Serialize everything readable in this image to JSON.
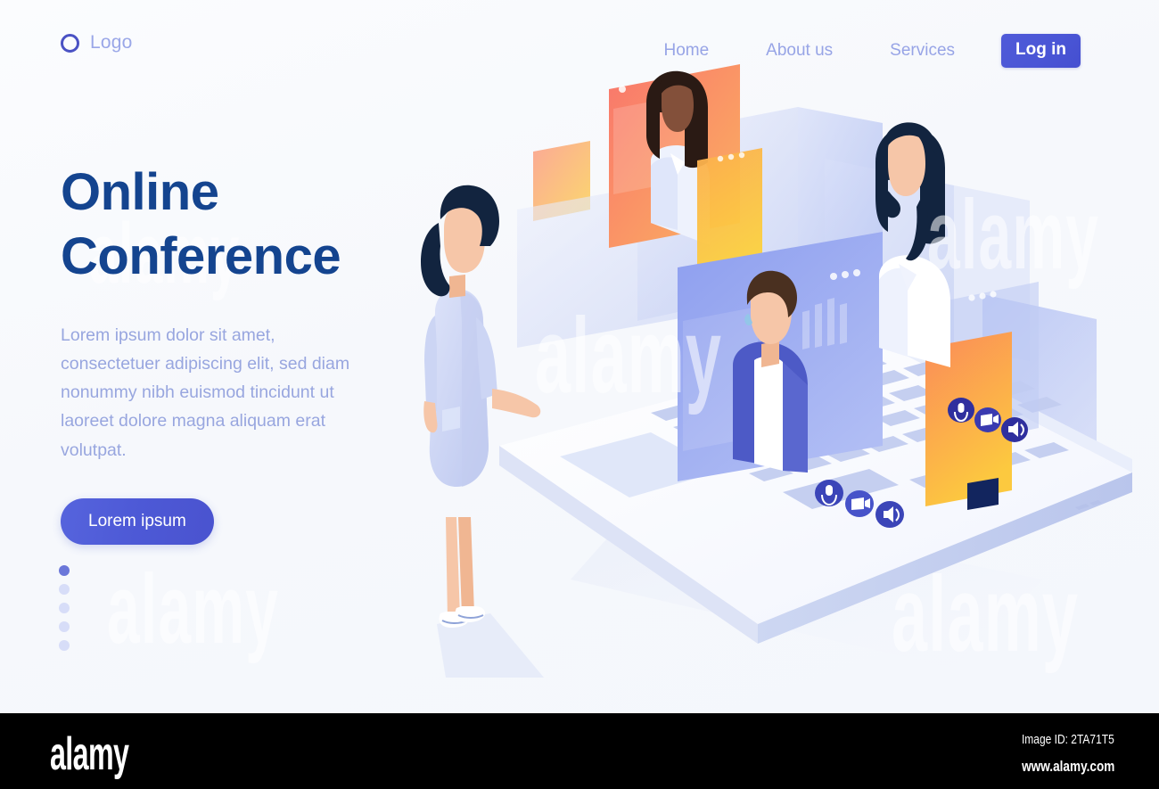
{
  "page": {
    "background_color": "#f8fafd",
    "accent_color": "#4a56d6",
    "title_color": "#14448f",
    "muted_text_color": "#98a6df"
  },
  "header": {
    "brand": {
      "icon": "circle-outline-icon",
      "label": "Logo"
    },
    "nav_items": [
      {
        "label": "Home"
      },
      {
        "label": "About us"
      },
      {
        "label": "Services"
      }
    ],
    "login_button": {
      "label": "Log in",
      "background_color": "#4a56d6",
      "text_color": "#ffffff"
    }
  },
  "hero": {
    "title_line1": "Online",
    "title_line2": "Conference",
    "paragraph": "Lorem ipsum dolor sit amet, consectetuer adipiscing elit, sed diam nonummy nibh euismod tincidunt ut laoreet dolore magna aliquam erat volutpat.",
    "cta_label": "Lorem ipsum",
    "cta_color": "#4d59d6"
  },
  "pagination": {
    "total": 5,
    "active_index": 0,
    "active_color": "#6b77d9",
    "inactive_color": "#d7ddf8"
  },
  "illustration": {
    "name": "isometric-online-conference-scene",
    "description": "Isometric laptop with floating video-call windows and participants",
    "laptop": {
      "body_color": "#fdfeff",
      "key_color": "#c3cdf0",
      "edge_color": "#b6c2ea"
    },
    "standing_person": {
      "name": "woman-standing-back-view",
      "dress_color": "#ccd5f4",
      "hair_color": "#1b2a4e",
      "skin_color": "#f6c6a8",
      "shoe_color": "#ffffff"
    },
    "call_windows": [
      {
        "name": "video-window-coral",
        "participant": "woman-dark-hair-white-blouse",
        "color_from": "#f9766c",
        "color_to": "#fbb360",
        "dots": 1
      },
      {
        "name": "video-window-periwinkle",
        "participant": "man-blue-cardigan",
        "color_from": "#8d9eef",
        "color_to": "#a9b7f4",
        "dots": 3
      },
      {
        "name": "video-window-amber",
        "participant": "woman-long-dark-hair",
        "color_from": "#fb8a5a",
        "color_to": "#fcc93f",
        "dots": 3
      }
    ],
    "call_controls": [
      {
        "name": "microphone-icon",
        "circle_color": "#2f2f9e"
      },
      {
        "name": "video-camera-icon",
        "circle_color": "#2f2f9e"
      },
      {
        "name": "speaker-icon",
        "circle_color": "#2f2f9e"
      }
    ],
    "background_cards": [
      {
        "name": "card-orange-small",
        "color_from": "#fba08a",
        "color_to": "#fcd45e"
      },
      {
        "name": "card-periwinkle-wide",
        "color_from": "#e4e9fb",
        "color_to": "#c4cff4"
      },
      {
        "name": "card-periwinkle-right",
        "color_from": "#c9d3f5",
        "color_to": "#b6c4f1"
      },
      {
        "name": "card-periwinkle-small",
        "color_from": "#dde4fa",
        "color_to": "#c8d2f5"
      }
    ]
  },
  "watermark": {
    "logo_text": "alamy",
    "image_id_label": "Image ID: 2TA71T5",
    "url": "www.alamy.com",
    "ghost_text": "alamy",
    "bar_color": "#000000"
  }
}
